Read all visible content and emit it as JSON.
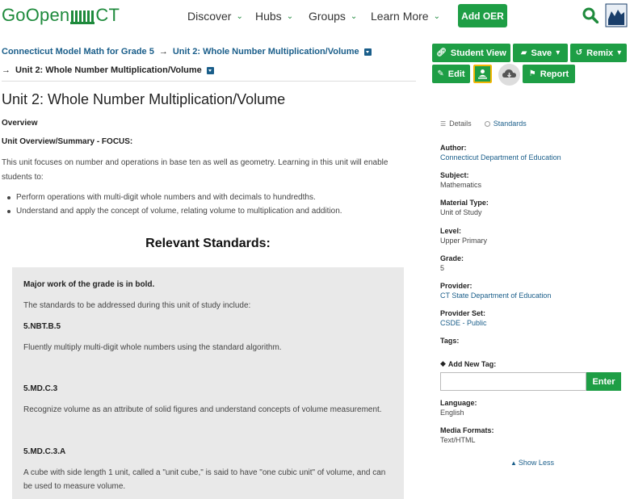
{
  "brand": {
    "logo_text_left": "GoOpen",
    "logo_text_right": "CT",
    "accent": "#1e9e45",
    "link": "#1a5e8a"
  },
  "nav": {
    "items": [
      {
        "label": "Discover"
      },
      {
        "label": "Hubs"
      },
      {
        "label": "Groups"
      },
      {
        "label": "Learn More"
      }
    ],
    "add_label": "Add OER"
  },
  "breadcrumb": {
    "item1": "Connecticut Model Math for Grade 5",
    "item2": "Unit 2: Whole Number Multiplication/Volume",
    "item3": "Unit 2: Whole Number Multiplication/Volume",
    "separator": "→"
  },
  "main": {
    "title": "Unit 2: Whole Number Multiplication/Volume",
    "overview_heading": "Overview",
    "summary_heading": "Unit Overview/Summary - FOCUS:",
    "paragraph": "This unit focuses on number and operations in base ten as well as geometry.  Learning in this unit will enable students to:",
    "bullets": [
      "Perform operations with multi-digit whole numbers and with decimals to hundredths.",
      "Understand and apply the concept of volume, relating volume to multiplication and addition."
    ],
    "standards_heading": "Relevant Standards:",
    "box": {
      "intro_bold": "Major work of the grade is in bold.",
      "intro": "The standards to be addressed during this unit of study include:",
      "s1_code": "5.NBT.B.5",
      "s1_text": "Fluently multiply multi-digit whole numbers using the standard algorithm.",
      "s2_code": "5.MD.C.3",
      "s2_text": "Recognize volume as an attribute of solid figures and understand concepts of volume measurement.",
      "s3_code": "5.MD.C.3.A",
      "s3_text_line1": "A cube with side length 1 unit, called a \"unit cube,\" is said to have \"one cubic unit\" of volume, and can",
      "s3_text_line2": "be used to measure volume."
    }
  },
  "actions": {
    "student_view": "Student View",
    "save": "Save",
    "remix": "Remix",
    "edit": "Edit",
    "report": "Report"
  },
  "details": {
    "tab_details": "Details",
    "tab_standards": "Standards",
    "author_label": "Author:",
    "author": "Connecticut Department of Education",
    "subject_label": "Subject:",
    "subject": "Mathematics",
    "material_label": "Material Type:",
    "material": "Unit of Study",
    "level_label": "Level:",
    "level": "Upper Primary",
    "grade_label": "Grade:",
    "grade": "5",
    "provider_label": "Provider:",
    "provider": "CT State Department of Education",
    "provider_set_label": "Provider Set:",
    "provider_set": "CSDE - Public",
    "tags_label": "Tags:",
    "add_tag_label": "Add New Tag:",
    "tag_placeholder": "",
    "enter_label": "Enter",
    "language_label": "Language:",
    "language": "English",
    "media_label": "Media Formats:",
    "media": "Text/HTML",
    "show_less": "Show Less"
  }
}
